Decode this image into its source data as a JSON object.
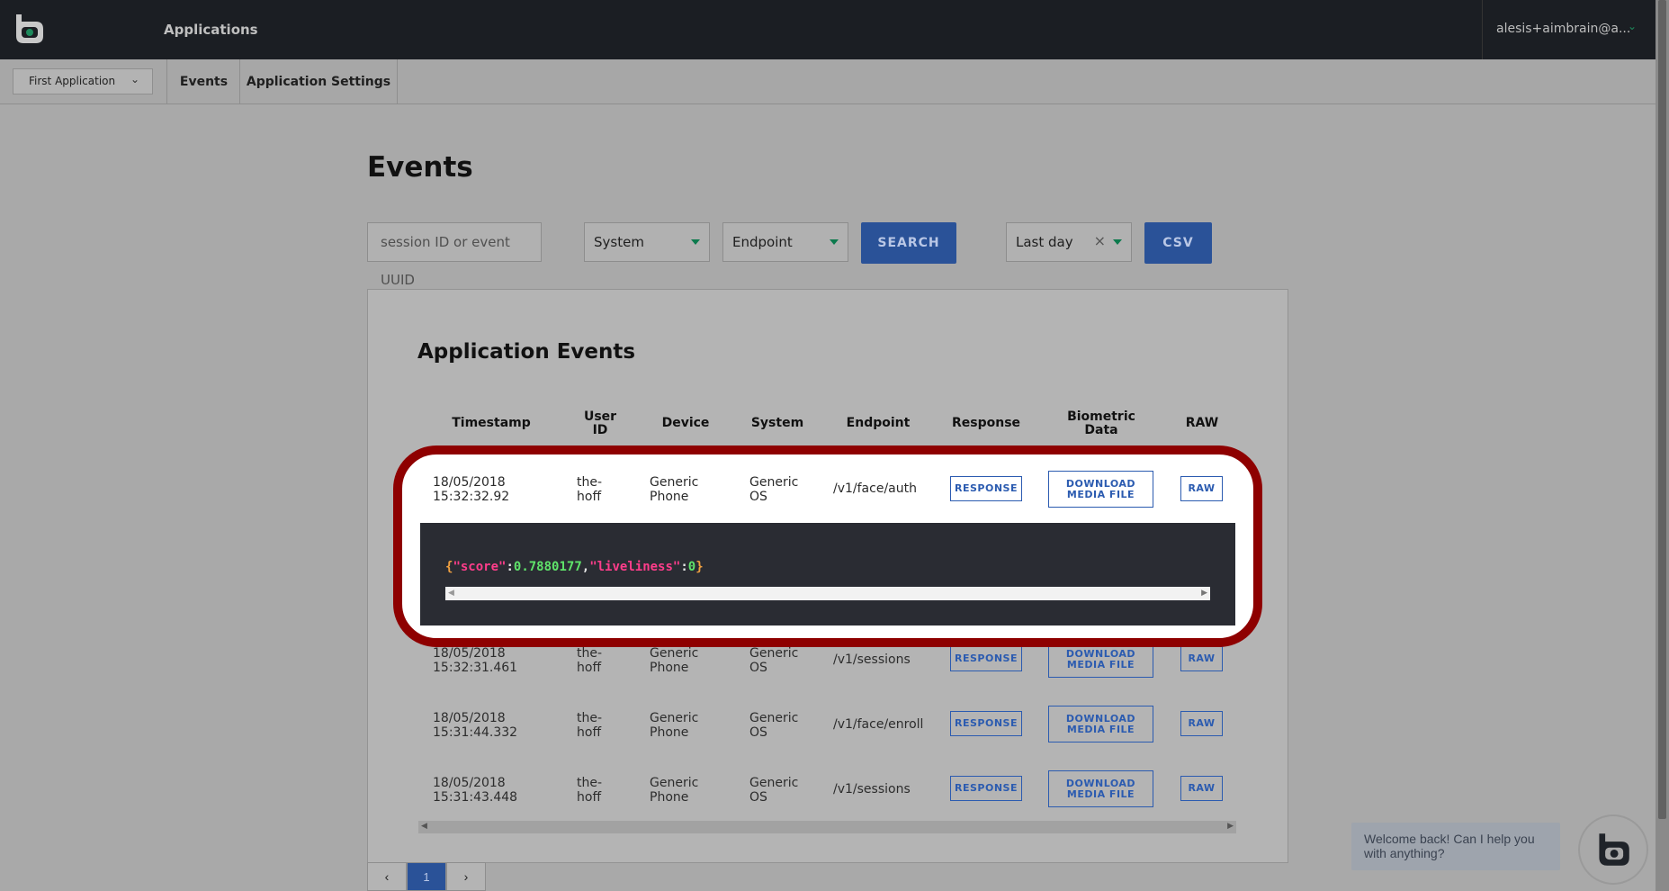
{
  "header": {
    "title": "Applications",
    "user": "alesis+aimbrain@a..."
  },
  "subnav": {
    "app_selector": "First Application",
    "tabs": [
      "Events",
      "Application Settings"
    ]
  },
  "page": {
    "title": "Events"
  },
  "filters": {
    "search_placeholder": "session ID or event UUID",
    "system": "System",
    "endpoint": "Endpoint",
    "search_label": "SEARCH",
    "range": "Last day",
    "clear_symbol": "×",
    "csv_label": "CSV"
  },
  "events": {
    "title": "Application Events",
    "columns": [
      "Timestamp",
      "User\nID",
      "Device",
      "System",
      "Endpoint",
      "Response",
      "Biometric\nData",
      "RAW"
    ],
    "rows": [
      {
        "date": "18/05/2018",
        "time": "15:32:32.92",
        "user1": "the-",
        "user2": "hoff",
        "dev1": "Generic",
        "dev2": "Phone",
        "sys1": "Generic",
        "sys2": "OS",
        "endpoint": "/v1/face/auth"
      },
      {
        "date": "18/05/2018",
        "time": "15:32:31.461",
        "user1": "the-",
        "user2": "hoff",
        "dev1": "Generic",
        "dev2": "Phone",
        "sys1": "Generic",
        "sys2": "OS",
        "endpoint": "/v1/sessions"
      },
      {
        "date": "18/05/2018",
        "time": "15:31:44.332",
        "user1": "the-",
        "user2": "hoff",
        "dev1": "Generic",
        "dev2": "Phone",
        "sys1": "Generic",
        "sys2": "OS",
        "endpoint": "/v1/face/enroll"
      },
      {
        "date": "18/05/2018",
        "time": "15:31:43.448",
        "user1": "the-",
        "user2": "hoff",
        "dev1": "Generic",
        "dev2": "Phone",
        "sys1": "Generic",
        "sys2": "OS",
        "endpoint": "/v1/sessions"
      }
    ],
    "buttons": {
      "response": "RESPONSE",
      "download1": "DOWNLOAD",
      "download2": "MEDIA FILE",
      "raw": "RAW"
    },
    "expanded_response": {
      "open": "{",
      "key1": "\"score\"",
      "colon": ":",
      "val1": "0.7880177",
      "comma": ",",
      "key2": "\"liveliness\"",
      "val2": "0",
      "close": "}"
    }
  },
  "pagination": {
    "prev": "‹",
    "current": "1",
    "next": "›"
  },
  "chat": {
    "message": "Welcome back! Can I help you with anything?"
  },
  "colors": {
    "accent": "#2a5298",
    "highlight": "#8e0000",
    "topbar": "#1b1e23"
  }
}
